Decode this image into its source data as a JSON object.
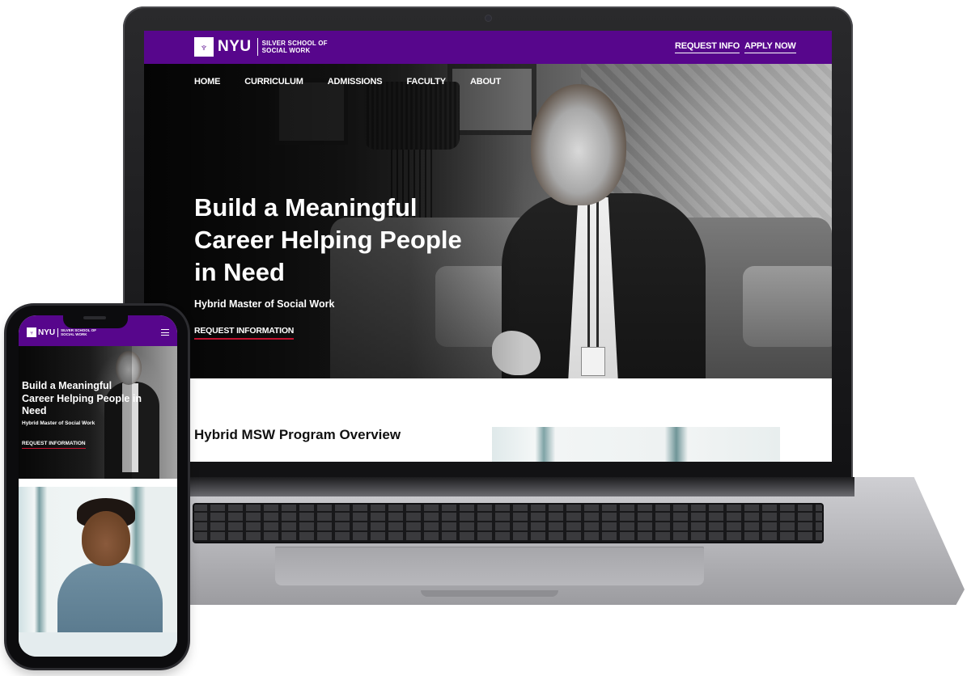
{
  "laptop": {
    "header": {
      "logo_mark": "NYU",
      "logo_school": "SILVER SCHOOL OF SOCIAL WORK",
      "request_info": "REQUEST INFO",
      "apply_now": "APPLY NOW"
    },
    "nav": {
      "items": [
        "HOME",
        "CURRICULUM",
        "ADMISSIONS",
        "FACULTY",
        "ABOUT"
      ]
    },
    "hero": {
      "title": "Build a Meaningful Career Helping People in Need",
      "subtitle": "Hybrid Master of Social Work",
      "cta": "REQUEST INFORMATION"
    },
    "overview": {
      "title": "Hybrid MSW Program Overview"
    }
  },
  "phone": {
    "header": {
      "logo_mark": "NYU",
      "logo_school": "SILVER SCHOOL OF SOCIAL WORK",
      "menu_icon": "hamburger-menu-icon"
    },
    "hero": {
      "title": "Build a Meaningful Career Helping People in Need",
      "subtitle": "Hybrid Master of Social Work",
      "cta": "REQUEST INFORMATION"
    }
  },
  "colors": {
    "brand_purple": "#57068c",
    "accent_red": "#c4122f",
    "text_dark": "#111111"
  }
}
